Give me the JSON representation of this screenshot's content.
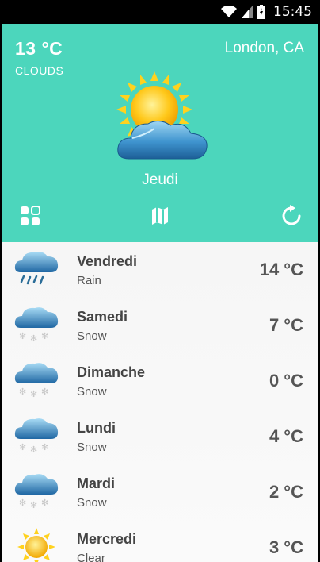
{
  "status": {
    "time": "15:45"
  },
  "header": {
    "temp": "13 °C",
    "condition": "CLOUDS",
    "city": "London, CA",
    "day": "Jeudi",
    "icon": "sun-cloud-icon"
  },
  "forecast": [
    {
      "day": "Vendredi",
      "cond": "Rain",
      "temp": "14 °C",
      "icon": "rain"
    },
    {
      "day": "Samedi",
      "cond": "Snow",
      "temp": "7 °C",
      "icon": "snow"
    },
    {
      "day": "Dimanche",
      "cond": "Snow",
      "temp": "0 °C",
      "icon": "snow"
    },
    {
      "day": "Lundi",
      "cond": "Snow",
      "temp": "4 °C",
      "icon": "snow"
    },
    {
      "day": "Mardi",
      "cond": "Snow",
      "temp": "2 °C",
      "icon": "snow"
    },
    {
      "day": "Mercredi",
      "cond": "Clear",
      "temp": "3 °C",
      "icon": "sun"
    }
  ],
  "colors": {
    "header": "#4cd6bc",
    "text_dark": "#444444"
  }
}
